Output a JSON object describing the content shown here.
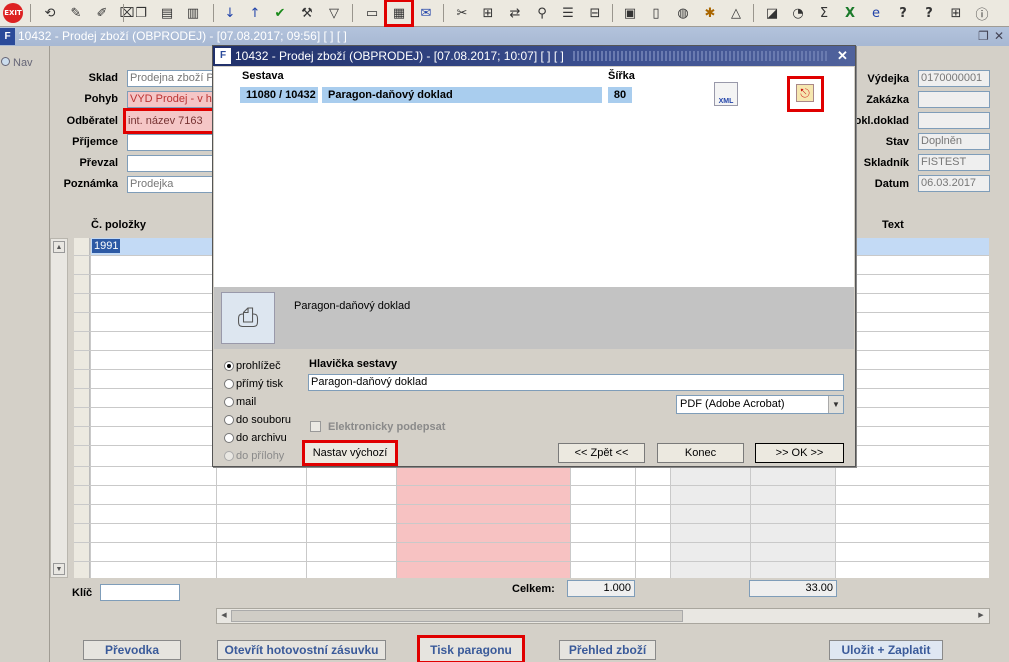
{
  "toolbar": {
    "exit_label": "EXIT"
  },
  "main_window": {
    "title": "10432 - Prodej zboží (OBPRODEJ) - [07.08.2017; 09:56]  [ ]  [ ]",
    "nav_label": "Nav"
  },
  "form": {
    "sklad": {
      "label": "Sklad",
      "value": "Prodejna zboží P"
    },
    "pohyb": {
      "label": "Pohyb",
      "value": "VYD Prodej - v h"
    },
    "odberatel": {
      "label": "Odběratel",
      "value": "int. název 7163"
    },
    "prijemce": {
      "label": "Příjemce",
      "value": ""
    },
    "prevzal": {
      "label": "Převzal",
      "value": ""
    },
    "poznamka": {
      "label": "Poznámka",
      "value": "Prodejka"
    },
    "vydejka": {
      "label": "Výdejka",
      "value": "0170000001"
    },
    "zakazka": {
      "label": "Zakázka",
      "value": ""
    },
    "dokl_doklad": {
      "label": "okl.doklad",
      "value": ""
    },
    "stav": {
      "label": "Stav",
      "value": "Doplněn"
    },
    "skladnik": {
      "label": "Skladník",
      "value": "FISTEST"
    },
    "datum": {
      "label": "Datum",
      "value": "06.03.2017"
    }
  },
  "grid": {
    "col_polozky": "Č. položky",
    "col_text": "Text",
    "first_row_value": "1991"
  },
  "footer": {
    "klic_label": "Klíč",
    "celkem_label": "Celkem:",
    "celkem_qty": "1.000",
    "celkem_sum": "33.00"
  },
  "bottom_buttons": {
    "prevodka": "Převodka",
    "otevrit": "Otevřít hotovostní zásuvku",
    "tisk": "Tisk paragonu",
    "prehled": "Přehled zboží",
    "ulozit": "Uložit + Zaplatit"
  },
  "dialog": {
    "title": "10432 - Prodej zboží (OBPRODEJ) - [07.08.2017; 10:07]  [ ]  [ ]",
    "col_sestava": "Sestava",
    "col_sirka": "Šířka",
    "row_code": "11080 / 10432",
    "row_name": "Paragon-daňový doklad",
    "row_width": "80",
    "xml_label": "XML",
    "preview_title": "Paragon-daňový doklad",
    "output_options": [
      "prohlížeč",
      "přímý tisk",
      "mail",
      "do souboru",
      "do archivu",
      "do přílohy"
    ],
    "hlavicka_label": "Hlavička sestavy",
    "hlavicka_value": "Paragon-daňový doklad",
    "format_value": "PDF (Adobe Acrobat)",
    "esign_label": "Elektronicky podepsat",
    "btn_nastav": "Nastav výchozí",
    "btn_zpet": "<< Zpět <<",
    "btn_konec": "Konec",
    "btn_ok": ">> OK >>"
  }
}
